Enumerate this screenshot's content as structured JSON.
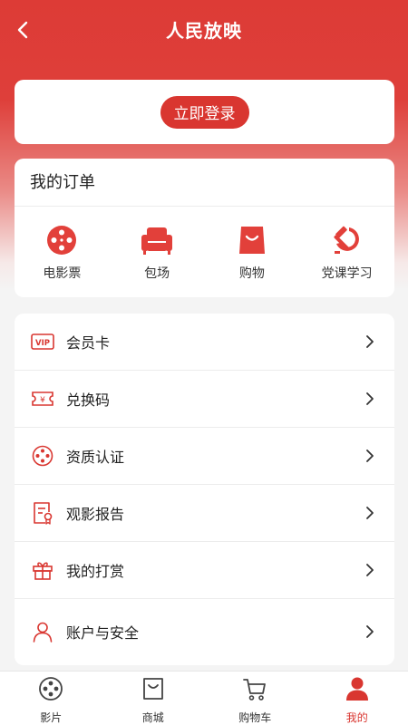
{
  "header": {
    "title": "人民放映"
  },
  "login": {
    "button_label": "立即登录"
  },
  "orders": {
    "title": "我的订单",
    "items": [
      {
        "label": "电影票",
        "icon": "film-reel-icon"
      },
      {
        "label": "包场",
        "icon": "sofa-icon"
      },
      {
        "label": "购物",
        "icon": "shopping-bag-icon"
      },
      {
        "label": "党课学习",
        "icon": "hammer-sickle-icon"
      }
    ]
  },
  "menu": {
    "items": [
      {
        "label": "会员卡",
        "icon": "vip-card-icon"
      },
      {
        "label": "兑换码",
        "icon": "ticket-yen-icon"
      },
      {
        "label": "资质认证",
        "icon": "film-reel-outline-icon"
      },
      {
        "label": "观影报告",
        "icon": "report-certificate-icon"
      },
      {
        "label": "我的打赏",
        "icon": "gift-icon"
      },
      {
        "label": "账户与安全",
        "icon": "user-icon"
      }
    ]
  },
  "tabbar": {
    "items": [
      {
        "label": "影片",
        "icon": "film-reel-tab-icon",
        "active": false
      },
      {
        "label": "商城",
        "icon": "shopping-bag-tab-icon",
        "active": false
      },
      {
        "label": "购物车",
        "icon": "cart-icon",
        "active": false
      },
      {
        "label": "我的",
        "icon": "person-filled-icon",
        "active": true
      }
    ]
  },
  "colors": {
    "accent": "#d93630",
    "header_red": "#dd3b36",
    "background": "#f4f4f4"
  }
}
